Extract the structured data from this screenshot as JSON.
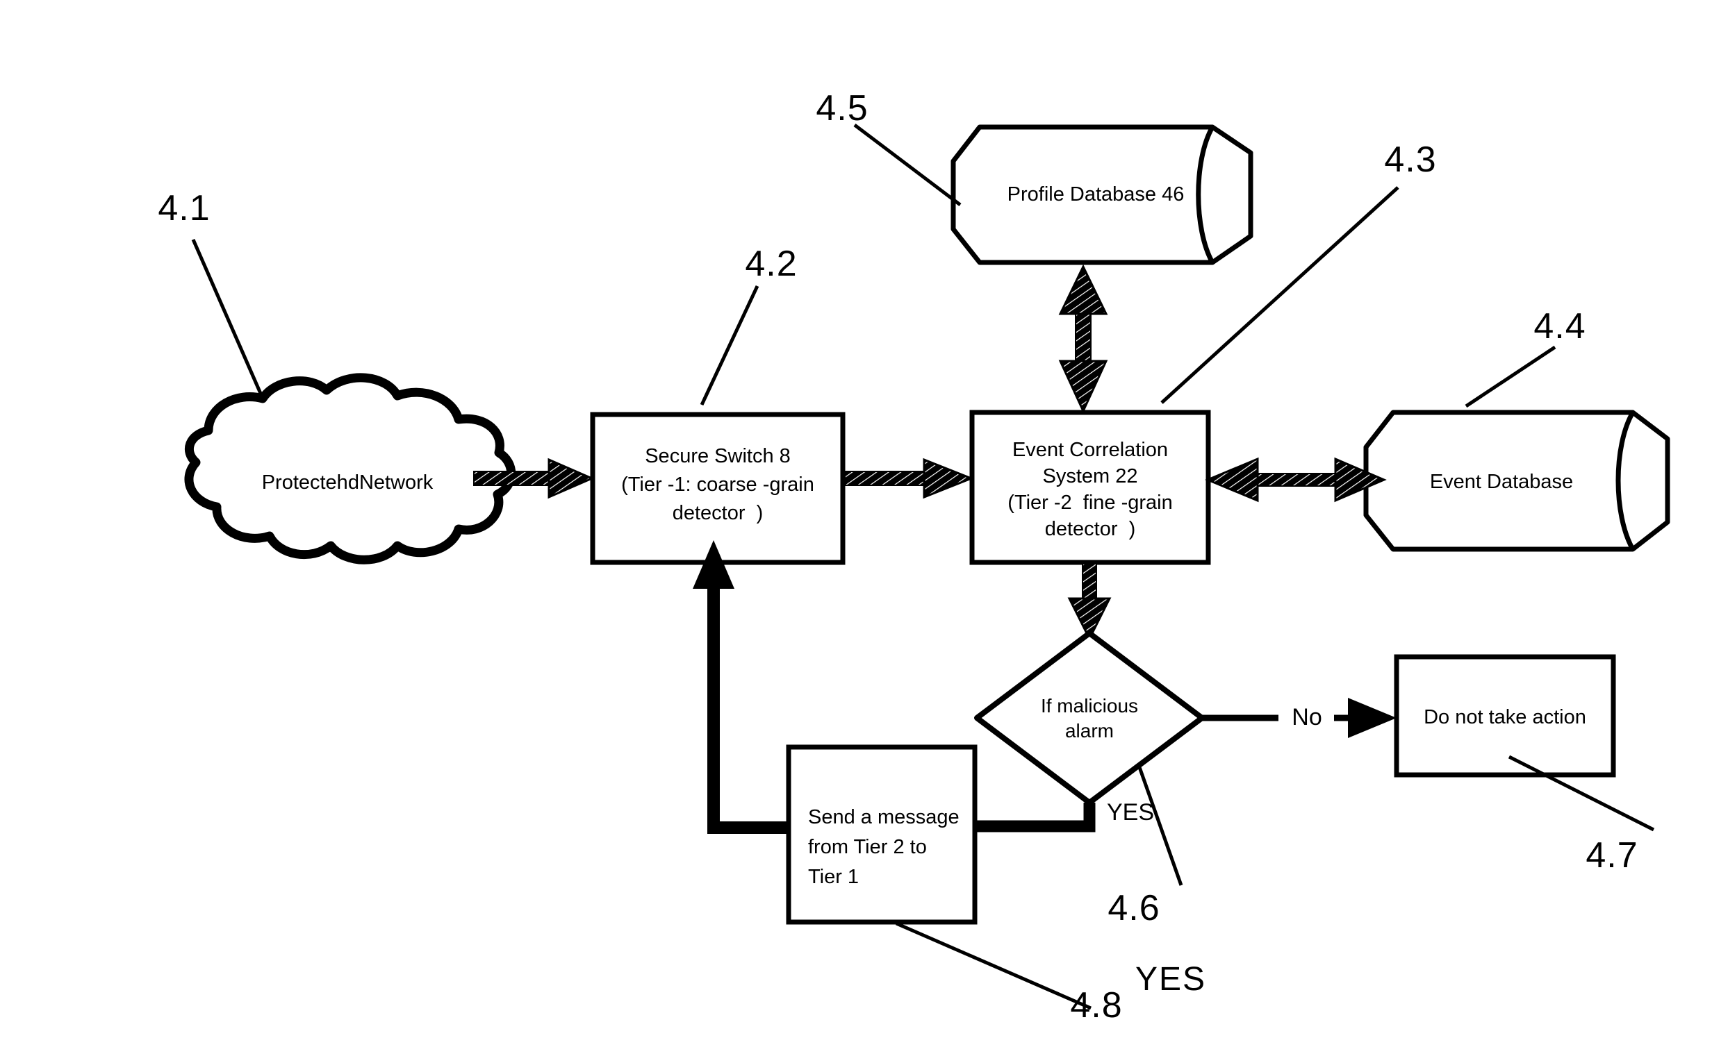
{
  "figure": {
    "type": "patent-flow-diagram",
    "background_color": "#ffffff",
    "stroke_color": "#000000"
  },
  "nodes": {
    "protected_network": {
      "shape": "cloud",
      "label": "ProtectehdNetwork"
    },
    "secure_switch": {
      "shape": "rectangle",
      "line1": "Secure Switch 8",
      "line2": "(Tier -1: coarse -grain",
      "line3": "detector  )"
    },
    "event_correlation_system": {
      "shape": "rectangle",
      "line1": "Event Correlation",
      "line2": "System 22",
      "line3": "(Tier -2  fine -grain",
      "line4": "detector  )"
    },
    "profile_database": {
      "shape": "cylinder",
      "label": "Profile Database 46"
    },
    "event_database": {
      "shape": "cylinder",
      "label": "Event Database"
    },
    "decision": {
      "shape": "diamond",
      "line1": "If malicious",
      "line2": "alarm"
    },
    "do_not_take_action": {
      "shape": "rectangle",
      "label": "Do not take action"
    },
    "send_message": {
      "shape": "rectangle",
      "line1": "Send a message",
      "line2": "from Tier 2 to",
      "line3": "Tier 1"
    }
  },
  "edge_labels": {
    "no": "No",
    "yes": "YES",
    "yes_standalone": "YES"
  },
  "reference_numerals": {
    "n41": "4.1",
    "n42": "4.2",
    "n43": "4.3",
    "n44": "4.4",
    "n45": "4.5",
    "n46": "4.6",
    "n47": "4.7",
    "n48": "4.8"
  },
  "reference_targets": {
    "n41": "protected_network",
    "n42": "secure_switch",
    "n43": "event_correlation_system",
    "n44": "event_database",
    "n45": "profile_database",
    "n46": "decision",
    "n47": "do_not_take_action",
    "n48": "send_message"
  }
}
